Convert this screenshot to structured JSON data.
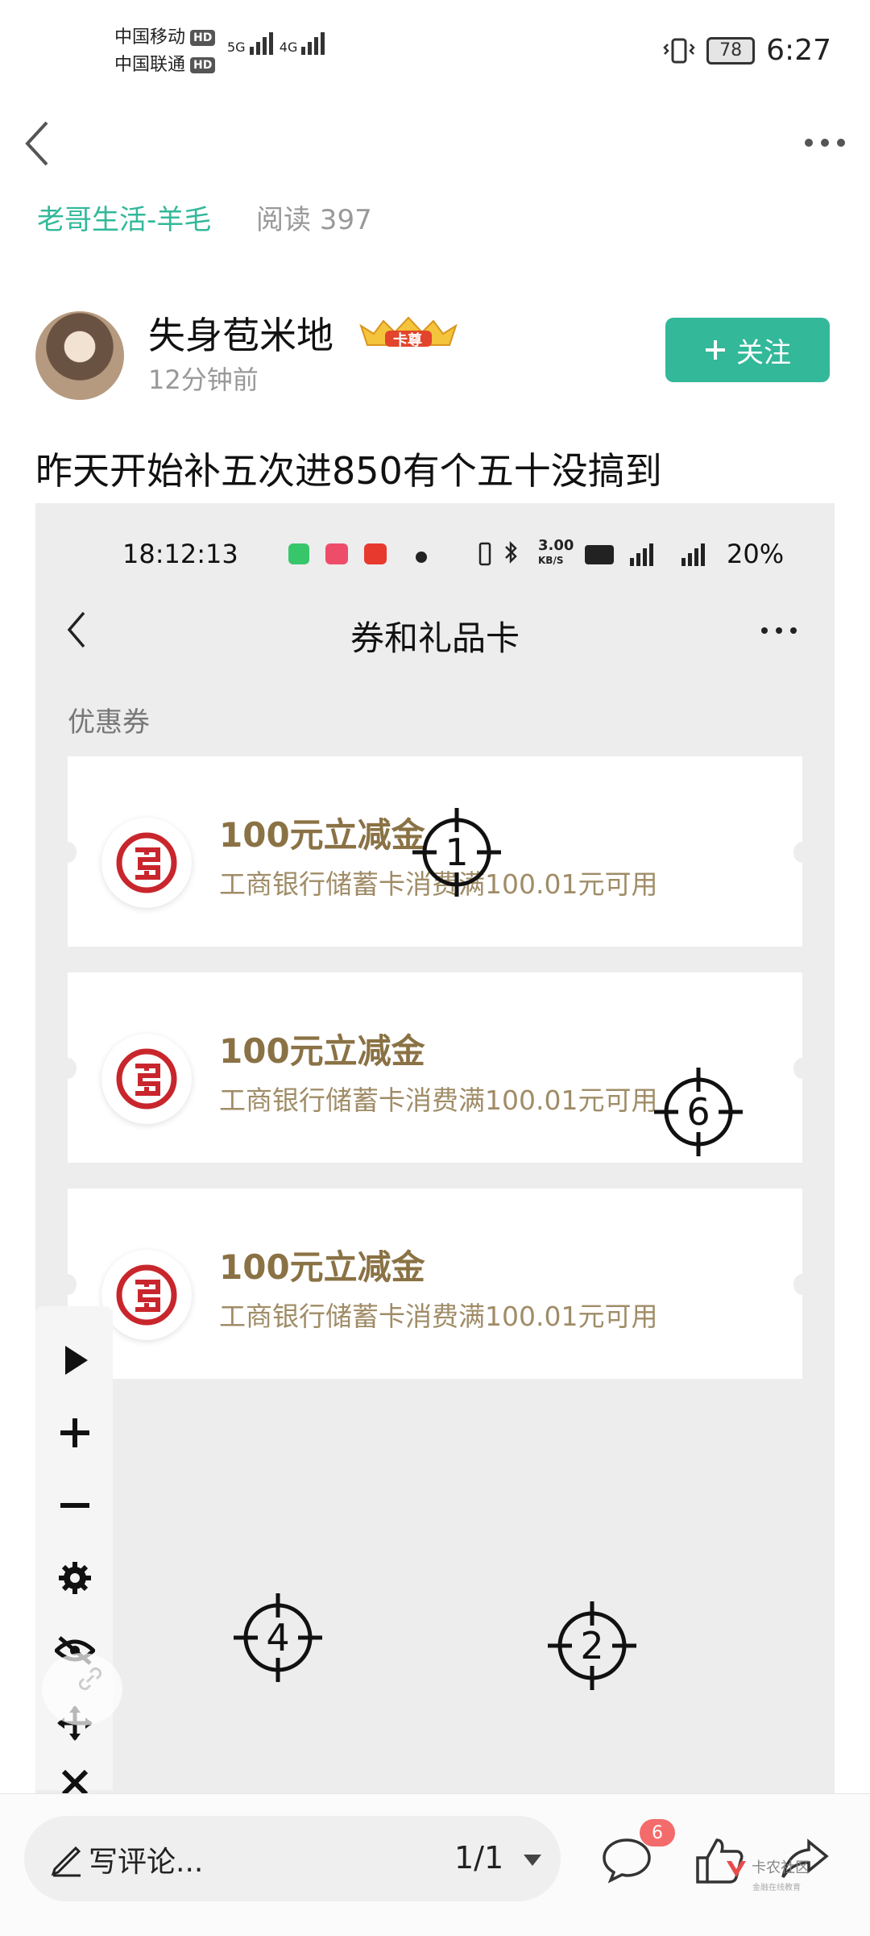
{
  "status_bar": {
    "carrier1": "中国移动",
    "carrier2": "中国联通",
    "hd": "HD",
    "net1": "5G",
    "net2": "4G",
    "battery": "78",
    "time": "6:27"
  },
  "header": {
    "group": "老哥生活-羊毛",
    "reads": "阅读 397"
  },
  "author": {
    "name": "失身苞米地",
    "badge": "卡尊",
    "time": "12分钟前",
    "follow": "关注"
  },
  "post": {
    "title": "昨天开始补五次进850有个五十没搞到"
  },
  "screenshot": {
    "status_time": "18:12:13",
    "status_speed_top": "3.00",
    "status_speed_bottom": "KB/S",
    "status_battery": "20%",
    "page_title": "券和礼品卡",
    "section": "优惠券",
    "coupons": [
      {
        "title": "100元立减金",
        "desc": "工商银行储蓄卡消费满100.01元可用"
      },
      {
        "title": "100元立减金",
        "desc": "工商银行储蓄卡消费满100.01元可用"
      },
      {
        "title": "100元立减金",
        "desc": "工商银行储蓄卡消费满100.01元可用"
      }
    ],
    "markers": [
      "1",
      "6",
      "4",
      "2"
    ]
  },
  "bottom": {
    "comment_placeholder": "写评论...",
    "pager": "1/1",
    "comment_count": "6",
    "watermark_line1": "卡农社区",
    "watermark_line2": "金融在线教育"
  },
  "colors": {
    "accent": "#33b89a",
    "coupon_title": "#8a7245",
    "icbc_red": "#c8262c",
    "badge_red": "#f46b6b"
  }
}
